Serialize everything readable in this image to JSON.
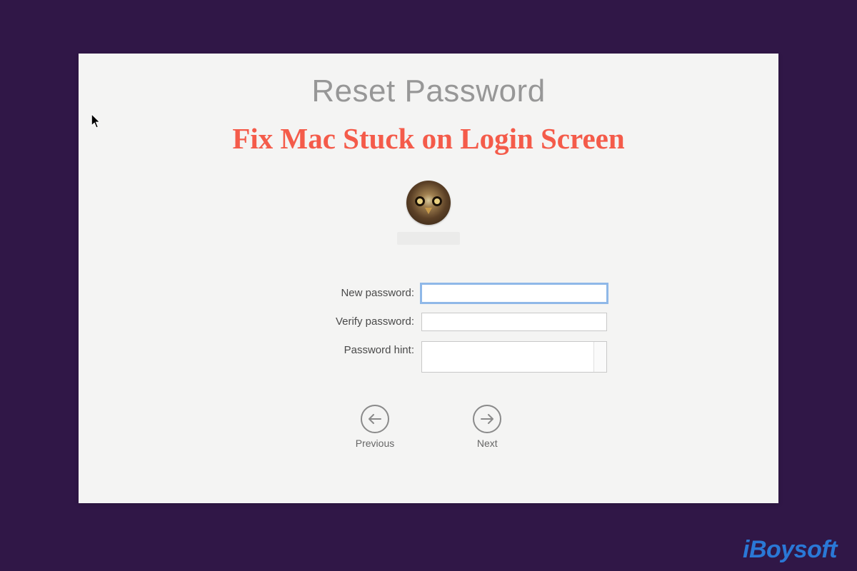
{
  "panel": {
    "title": "Reset Password"
  },
  "overlay": {
    "headline": "Fix Mac Stuck on Login Screen",
    "color": "#f45b4a"
  },
  "user": {
    "avatar_description": "owl-avatar"
  },
  "form": {
    "new_password": {
      "label": "New password:",
      "value": ""
    },
    "verify_password": {
      "label": "Verify password:",
      "value": ""
    },
    "password_hint": {
      "label": "Password hint:",
      "value": ""
    }
  },
  "nav": {
    "previous": "Previous",
    "next": "Next"
  },
  "watermark": {
    "text": "iBoysoft",
    "color": "#2a78d6"
  }
}
